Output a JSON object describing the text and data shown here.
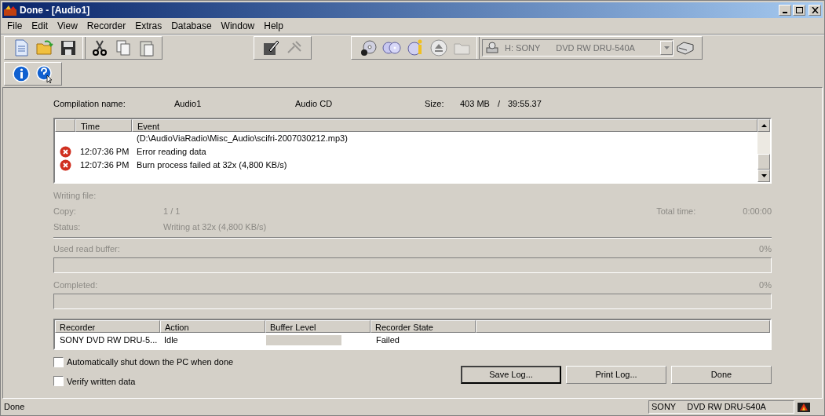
{
  "window": {
    "title": "Done - [Audio1]"
  },
  "menu": [
    "File",
    "Edit",
    "View",
    "Recorder",
    "Extras",
    "Database",
    "Window",
    "Help"
  ],
  "toolbar": {
    "drive_letter": "H: SONY",
    "drive_model": "DVD RW DRU-540A"
  },
  "compilation": {
    "name_label": "Compilation name:",
    "name": "Audio1",
    "type": "Audio CD",
    "size_label": "Size:",
    "size": "403 MB",
    "separator": "/",
    "duration": "39:55.37"
  },
  "log": {
    "columns": [
      "Time",
      "Event"
    ],
    "rows": [
      {
        "kind": "continuation",
        "time": "",
        "event": "(D:\\AudioViaRadio\\Misc_Audio\\scifri-2007030212.mp3)"
      },
      {
        "kind": "error",
        "time": "12:07:36 PM",
        "event": "Error reading data"
      },
      {
        "kind": "error",
        "time": "12:07:36 PM",
        "event": "Burn process failed at 32x (4,800 KB/s)"
      }
    ]
  },
  "details": {
    "writing_file_label": "Writing file:",
    "copy_label": "Copy:",
    "copy": "1 / 1",
    "total_time_label": "Total time:",
    "total_time": "0:00:00",
    "status_label": "Status:",
    "status": "Writing at 32x (4,800 KB/s)"
  },
  "read_buffer": {
    "label": "Used read buffer:",
    "percent": "0%",
    "level": 0
  },
  "completed": {
    "label": "Completed:",
    "percent": "0%",
    "level": 0
  },
  "recorders": {
    "columns": [
      "Recorder",
      "Action",
      "Buffer Level",
      "Recorder State"
    ],
    "rows": [
      {
        "recorder": "SONY DVD RW DRU-5...",
        "action": "Idle",
        "level": 0,
        "state": "Failed"
      }
    ]
  },
  "options": [
    {
      "label": "Automatically shut down the PC when done",
      "checked": false
    },
    {
      "label": "Verify written data",
      "checked": false
    }
  ],
  "buttons": [
    {
      "label": "Save Log...",
      "default": true
    },
    {
      "label": "Print Log...",
      "default": false
    },
    {
      "label": "Done",
      "default": false
    }
  ],
  "status_bar": {
    "text": "Done",
    "drive_vendor": "SONY",
    "drive_model": "DVD RW DRU-540A"
  }
}
